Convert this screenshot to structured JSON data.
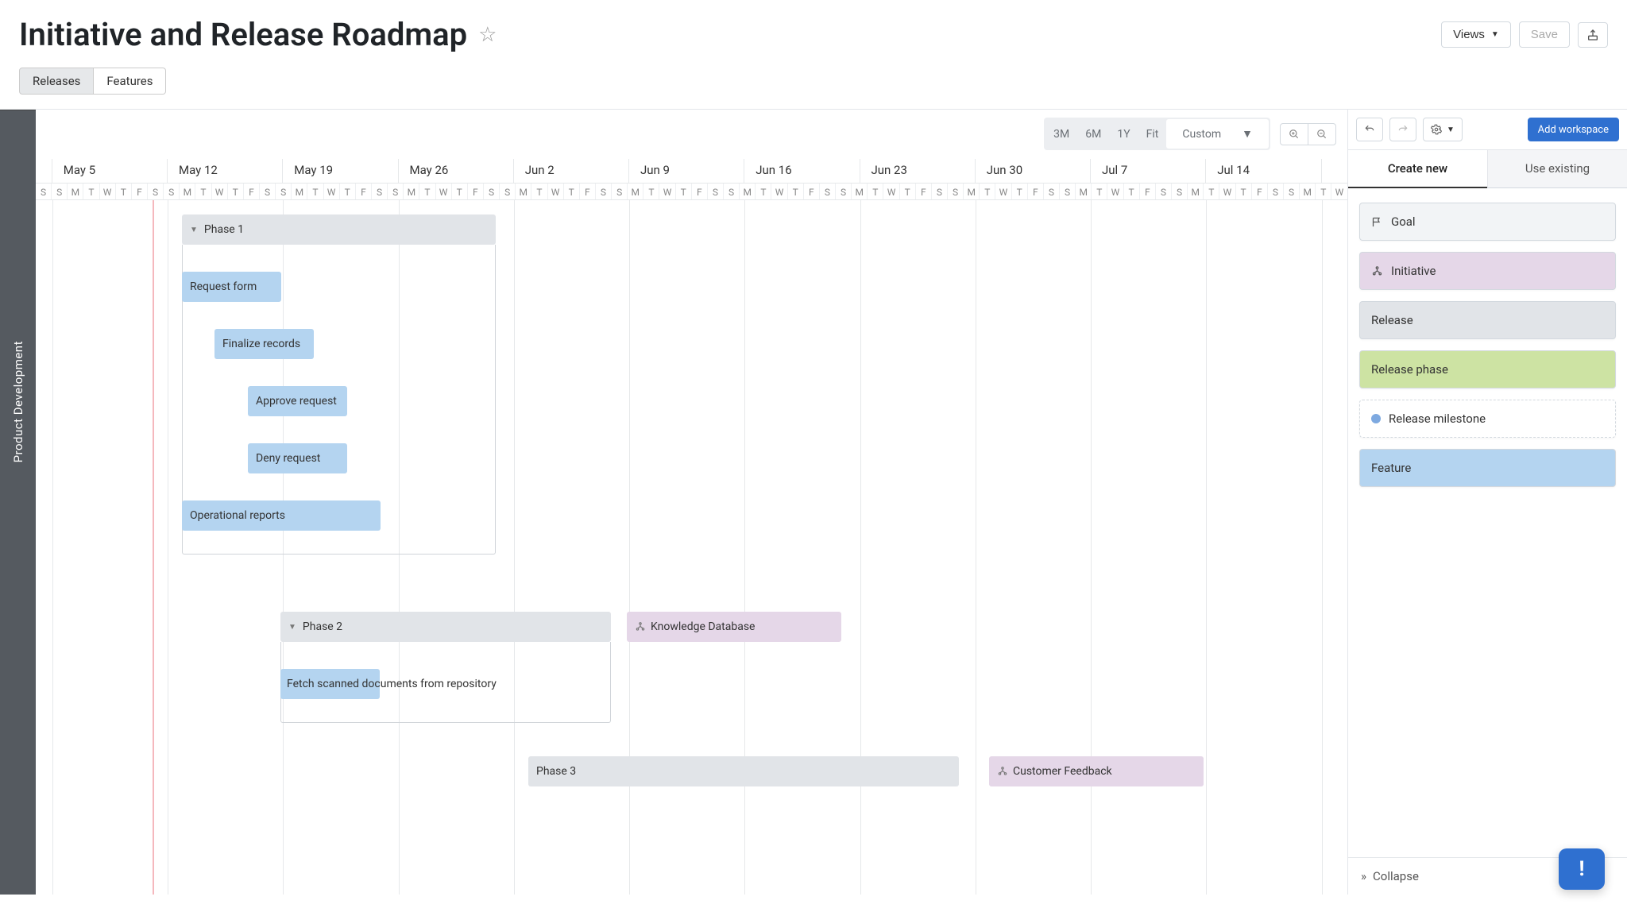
{
  "header": {
    "title": "Initiative and Release Roadmap",
    "views_label": "Views",
    "save_label": "Save"
  },
  "tabs": {
    "releases": "Releases",
    "features": "Features"
  },
  "sidebar": {
    "label": "Product Development"
  },
  "timeline": {
    "ranges": {
      "r3m": "3M",
      "r6m": "6M",
      "r1y": "1Y",
      "fit": "Fit",
      "custom": "Custom"
    },
    "weeks": [
      "May 5",
      "May 12",
      "May 19",
      "May 26",
      "Jun 2",
      "Jun 9",
      "Jun 16",
      "Jun 23",
      "Jun 30",
      "Jul 7",
      "Jul 14"
    ],
    "day_letters": [
      "S",
      "S",
      "M",
      "T",
      "W",
      "T",
      "F"
    ],
    "items": {
      "phase1": "Phase 1",
      "request_form": "Request form",
      "finalize_records": "Finalize records",
      "approve_request": "Approve request",
      "deny_request": "Deny request",
      "operational_reports": "Operational reports",
      "phase2": "Phase 2",
      "knowledge_db": "Knowledge Database",
      "fetch_docs": "Fetch scanned documents from repository",
      "phase3": "Phase 3",
      "customer_feedback": "Customer Feedback"
    }
  },
  "panel": {
    "add_workspace": "Add workspace",
    "tab_create": "Create new",
    "tab_use": "Use existing",
    "cards": {
      "goal": "Goal",
      "initiative": "Initiative",
      "release": "Release",
      "release_phase": "Release phase",
      "release_milestone": "Release milestone",
      "feature": "Feature"
    },
    "collapse": "Collapse"
  }
}
